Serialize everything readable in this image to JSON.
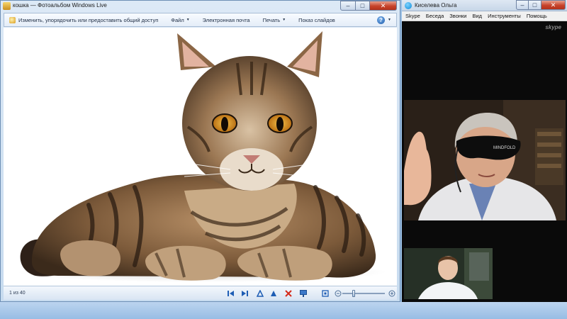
{
  "photo_viewer": {
    "title": "кошка — Фотоальбом Windows Live",
    "commands": {
      "organize": "Изменить, упорядочить или предоставить общий доступ",
      "file": "Файл",
      "email": "Электронная почта",
      "print": "Печать",
      "slideshow": "Показ слайдов"
    },
    "help": "?",
    "counter": "1 из 40",
    "colors": {
      "close": "#c7432a",
      "accent": "#1b5aa8"
    }
  },
  "skype": {
    "title": "Киселева Ольга",
    "menu": [
      "Skype",
      "Беседа",
      "Звонки",
      "Вид",
      "Инструменты",
      "Помощь"
    ],
    "brand": "skype",
    "mask_label": "MINDFOLD"
  }
}
